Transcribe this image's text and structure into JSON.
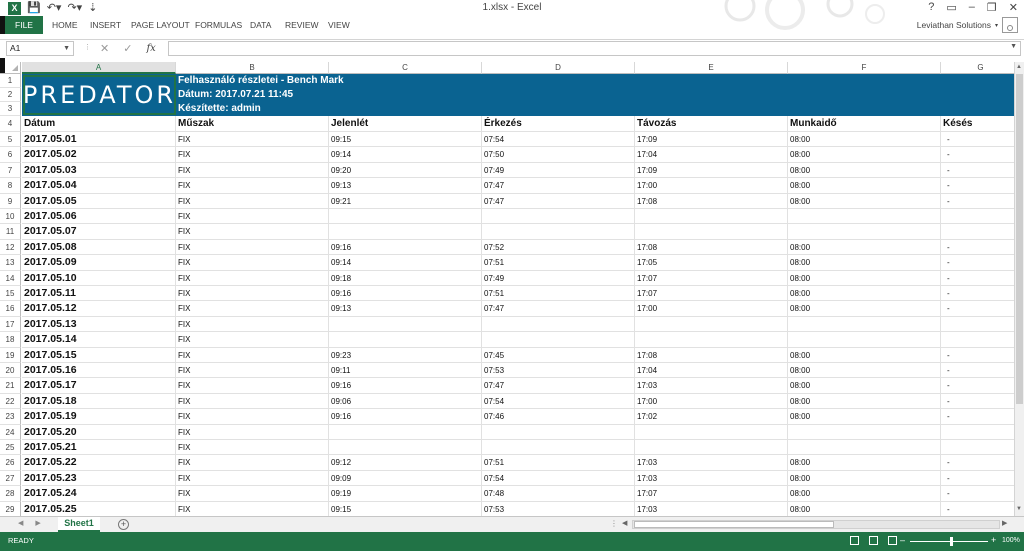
{
  "window": {
    "title": "1.xlsx - Excel",
    "controls": [
      "?",
      "▭",
      "–",
      "❐",
      "✕"
    ]
  },
  "ribbon": {
    "tabs": [
      "FILE",
      "HOME",
      "INSERT",
      "PAGE LAYOUT",
      "FORMULAS",
      "DATA",
      "REVIEW",
      "VIEW"
    ],
    "account": "Leviathan Solutions"
  },
  "formula_bar": {
    "name_box": "A1",
    "fx_label": "fx",
    "value": ""
  },
  "columns": [
    "A",
    "B",
    "C",
    "D",
    "E",
    "F",
    "G"
  ],
  "banner": {
    "logo_text": "PREDATOR",
    "line1": "Felhasználó részletei - Bench Mark",
    "line2": "Dátum: 2017.07.21 11:45",
    "line3": "Készítette: admin"
  },
  "table": {
    "headers": [
      "Dátum",
      "Műszak",
      "Jelenlét",
      "Érkezés",
      "Távozás",
      "Munkaidő",
      "Késés"
    ],
    "rows": [
      [
        "2017.05.01",
        "FIX",
        "09:15",
        "07:54",
        "17:09",
        "08:00",
        "-"
      ],
      [
        "2017.05.02",
        "FIX",
        "09:14",
        "07:50",
        "17:04",
        "08:00",
        "-"
      ],
      [
        "2017.05.03",
        "FIX",
        "09:20",
        "07:49",
        "17:09",
        "08:00",
        "-"
      ],
      [
        "2017.05.04",
        "FIX",
        "09:13",
        "07:47",
        "17:00",
        "08:00",
        "-"
      ],
      [
        "2017.05.05",
        "FIX",
        "09:21",
        "07:47",
        "17:08",
        "08:00",
        "-"
      ],
      [
        "2017.05.06",
        "FIX",
        "",
        "",
        "",
        "",
        ""
      ],
      [
        "2017.05.07",
        "FIX",
        "",
        "",
        "",
        "",
        ""
      ],
      [
        "2017.05.08",
        "FIX",
        "09:16",
        "07:52",
        "17:08",
        "08:00",
        "-"
      ],
      [
        "2017.05.09",
        "FIX",
        "09:14",
        "07:51",
        "17:05",
        "08:00",
        "-"
      ],
      [
        "2017.05.10",
        "FIX",
        "09:18",
        "07:49",
        "17:07",
        "08:00",
        "-"
      ],
      [
        "2017.05.11",
        "FIX",
        "09:16",
        "07:51",
        "17:07",
        "08:00",
        "-"
      ],
      [
        "2017.05.12",
        "FIX",
        "09:13",
        "07:47",
        "17:00",
        "08:00",
        "-"
      ],
      [
        "2017.05.13",
        "FIX",
        "",
        "",
        "",
        "",
        ""
      ],
      [
        "2017.05.14",
        "FIX",
        "",
        "",
        "",
        "",
        ""
      ],
      [
        "2017.05.15",
        "FIX",
        "09:23",
        "07:45",
        "17:08",
        "08:00",
        "-"
      ],
      [
        "2017.05.16",
        "FIX",
        "09:11",
        "07:53",
        "17:04",
        "08:00",
        "-"
      ],
      [
        "2017.05.17",
        "FIX",
        "09:16",
        "07:47",
        "17:03",
        "08:00",
        "-"
      ],
      [
        "2017.05.18",
        "FIX",
        "09:06",
        "07:54",
        "17:00",
        "08:00",
        "-"
      ],
      [
        "2017.05.19",
        "FIX",
        "09:16",
        "07:46",
        "17:02",
        "08:00",
        "-"
      ],
      [
        "2017.05.20",
        "FIX",
        "",
        "",
        "",
        "",
        ""
      ],
      [
        "2017.05.21",
        "FIX",
        "",
        "",
        "",
        "",
        ""
      ],
      [
        "2017.05.22",
        "FIX",
        "09:12",
        "07:51",
        "17:03",
        "08:00",
        "-"
      ],
      [
        "2017.05.23",
        "FIX",
        "09:09",
        "07:54",
        "17:03",
        "08:00",
        "-"
      ],
      [
        "2017.05.24",
        "FIX",
        "09:19",
        "07:48",
        "17:07",
        "08:00",
        "-"
      ],
      [
        "2017.05.25",
        "FIX",
        "09:15",
        "07:53",
        "17:03",
        "08:00",
        "-"
      ]
    ]
  },
  "sheets": {
    "active": "Sheet1",
    "add_label": "+"
  },
  "status": {
    "text": "READY",
    "zoom": "100%"
  },
  "colors": {
    "excel_green": "#217346",
    "banner_blue": "#0a6391"
  }
}
